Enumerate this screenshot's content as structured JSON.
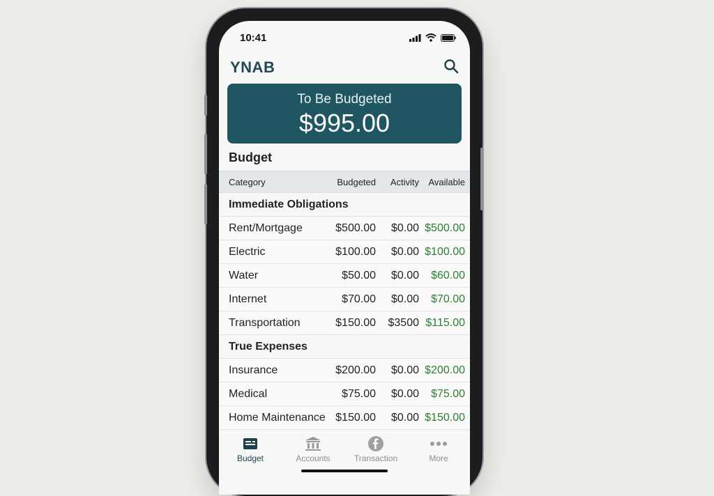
{
  "status": {
    "time": "10:41"
  },
  "app": {
    "logo": "YNAB"
  },
  "to_be_budgeted": {
    "label": "To Be Budgeted",
    "amount": "$995.00"
  },
  "budget": {
    "title": "Budget",
    "columns": [
      "Category",
      "Budgeted",
      "Activity",
      "Available"
    ],
    "groups": [
      {
        "name": "Immediate Obligations",
        "rows": [
          {
            "category": "Rent/Mortgage",
            "budgeted": "$500.00",
            "activity": "$0.00",
            "available": "$500.00"
          },
          {
            "category": "Electric",
            "budgeted": "$100.00",
            "activity": "$0.00",
            "available": "$100.00"
          },
          {
            "category": "Water",
            "budgeted": "$50.00",
            "activity": "$0.00",
            "available": "$60.00"
          },
          {
            "category": "Internet",
            "budgeted": "$70.00",
            "activity": "$0.00",
            "available": "$70.00"
          },
          {
            "category": "Transportation",
            "budgeted": "$150.00",
            "activity": "$3500",
            "available": "$115.00"
          }
        ]
      },
      {
        "name": "True Expenses",
        "rows": [
          {
            "category": "Insurance",
            "budgeted": "$200.00",
            "activity": "$0.00",
            "available": "$200.00"
          },
          {
            "category": "Medical",
            "budgeted": "$75.00",
            "activity": "$0.00",
            "available": "$75.00"
          },
          {
            "category": "Home Maintenance",
            "budgeted": "$150.00",
            "activity": "$0.00",
            "available": "$150.00"
          }
        ]
      }
    ]
  },
  "tabs": [
    {
      "label": "Budget",
      "icon": "budget-icon",
      "active": true
    },
    {
      "label": "Accounts",
      "icon": "bank-icon",
      "active": false
    },
    {
      "label": "Transaction",
      "icon": "transaction-icon",
      "active": false
    },
    {
      "label": "More",
      "icon": "more-icon",
      "active": false
    }
  ],
  "colors": {
    "brand": "#1f5662",
    "available_positive": "#2e7d32",
    "logo": "#1f4a55"
  }
}
